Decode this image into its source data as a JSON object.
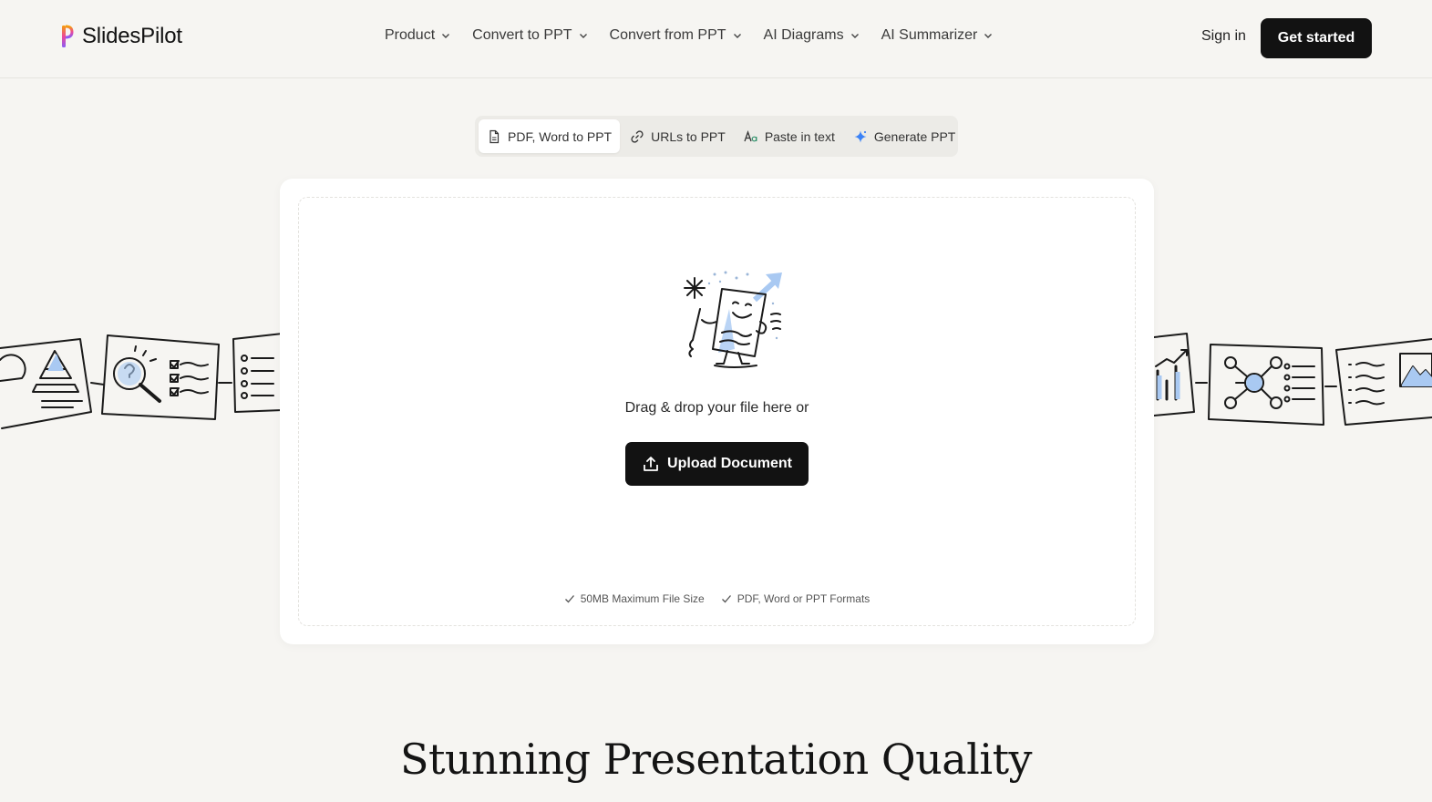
{
  "header": {
    "logo_text": "SlidesPilot",
    "nav": [
      {
        "label": "Product"
      },
      {
        "label": "Convert to PPT"
      },
      {
        "label": "Convert from PPT"
      },
      {
        "label": "AI Diagrams"
      },
      {
        "label": "AI Summarizer"
      }
    ],
    "sign_in": "Sign in",
    "get_started": "Get started"
  },
  "tabs": [
    {
      "label": "PDF, Word to PPT",
      "icon": "document-icon",
      "active": true
    },
    {
      "label": "URLs to PPT",
      "icon": "link-icon"
    },
    {
      "label": "Paste in text",
      "icon": "text-icon"
    },
    {
      "label": "Generate PPT",
      "icon": "sparkle-icon"
    }
  ],
  "upload": {
    "drag_text": "Drag & drop your file here or",
    "button_label": "Upload Document",
    "specs": [
      "50MB Maximum File Size",
      "PDF, Word or PPT Formats"
    ]
  },
  "heading": "Stunning Presentation Quality",
  "colors": {
    "background": "#f6f5f2",
    "button": "#121212",
    "accent_blue": "#a9c9f2",
    "sparkle": "#3b82f6"
  }
}
